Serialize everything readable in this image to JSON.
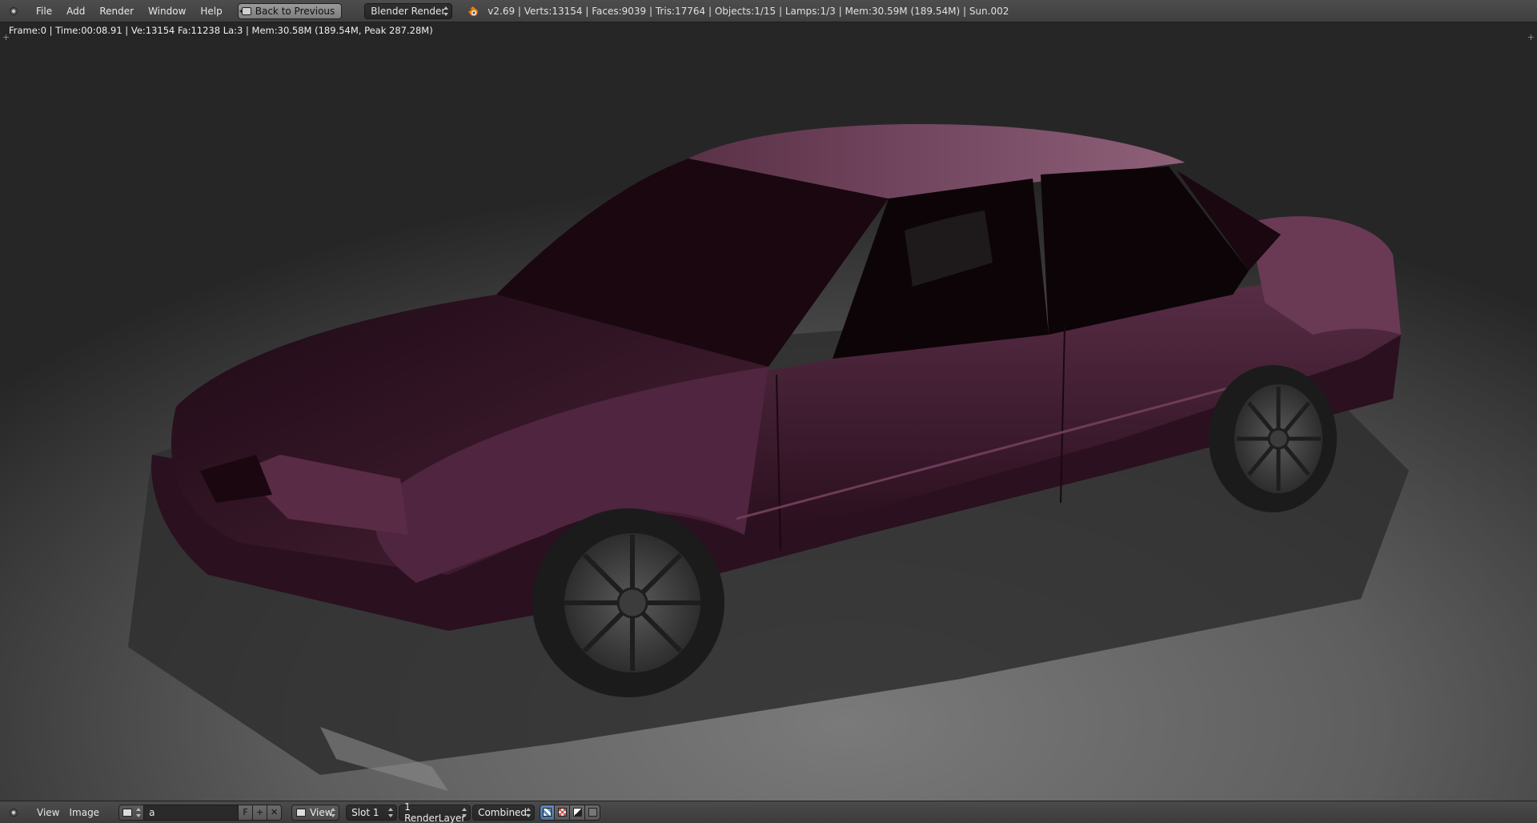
{
  "top_header": {
    "menus": [
      "File",
      "Add",
      "Render",
      "Window",
      "Help"
    ],
    "back_button_label": "Back to Previous",
    "render_engine": "Blender Render",
    "stats_text": "v2.69 | Verts:13154 | Faces:9039 | Tris:17764 | Objects:1/15 | Lamps:1/3 | Mem:30.59M (189.54M) | Sun.002"
  },
  "viewport": {
    "render_info": "Frame:0 | Time:00:08.91 | Ve:13154 Fa:11238 La:3 | Mem:30.58M (189.54M, Peak 287.28M)",
    "car_body_color": "#3d1a2c",
    "background_color": "#5b5b5b"
  },
  "bottom_header": {
    "menus": [
      "View",
      "Image"
    ],
    "image_name": "a",
    "fake_user_label": "F",
    "new_label": "+",
    "unlink_label": "✕",
    "view_label": "View",
    "slot_label": "Slot 1",
    "render_layer_label": "1 RenderLayer",
    "pass_label": "Combined"
  },
  "icons": {
    "area_toggle": "circle-dot-icon",
    "back": "back-arrow-icon",
    "logo": "blender-logo-icon",
    "image_browse": "image-icon"
  }
}
